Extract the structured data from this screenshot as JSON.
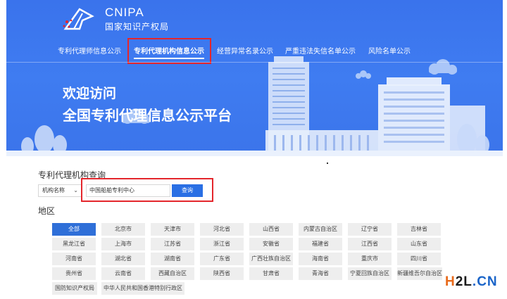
{
  "header": {
    "logo_en": "CNIPA",
    "logo_cn": "国家知识产权局"
  },
  "nav": {
    "items": [
      {
        "label": "专利代理师信息公示"
      },
      {
        "label": "专利代理机构信息公示"
      },
      {
        "label": "经营异常名录公示"
      },
      {
        "label": "严重违法失信名单公示"
      },
      {
        "label": "风险名单公示"
      }
    ],
    "active_index": 1
  },
  "banner": {
    "line1": "欢迎访问",
    "line2": "全国专利代理信息公示平台"
  },
  "search": {
    "title": "专利代理机构查询",
    "field_select": "机构名称",
    "input_value": "中国船舶专利中心",
    "button": "查询"
  },
  "region": {
    "label": "地区",
    "selected": "全部",
    "rows": [
      [
        "全部",
        "北京市",
        "天津市",
        "河北省",
        "山西省",
        "内蒙古自治区",
        "辽宁省",
        "吉林省"
      ],
      [
        "黑龙江省",
        "上海市",
        "江苏省",
        "浙江省",
        "安徽省",
        "福建省",
        "江西省",
        "山东省"
      ],
      [
        "河南省",
        "湖北省",
        "湖南省",
        "广东省",
        "广西壮族自治区",
        "海南省",
        "重庆市",
        "四川省"
      ],
      [
        "贵州省",
        "云南省",
        "西藏自治区",
        "陕西省",
        "甘肃省",
        "青海省",
        "宁夏回族自治区",
        "新疆维吾尔自治区"
      ],
      [
        "国防知识产权局",
        "中华人民共和国香港特别行政区"
      ]
    ]
  },
  "watermark": {
    "a": "H",
    "b": "2L",
    "c": ".CN"
  },
  "colors": {
    "banner": "#3f7cf1",
    "highlight": "#e4262c",
    "button": "#2a6fe4",
    "cell_selected": "#2f6fd8"
  }
}
